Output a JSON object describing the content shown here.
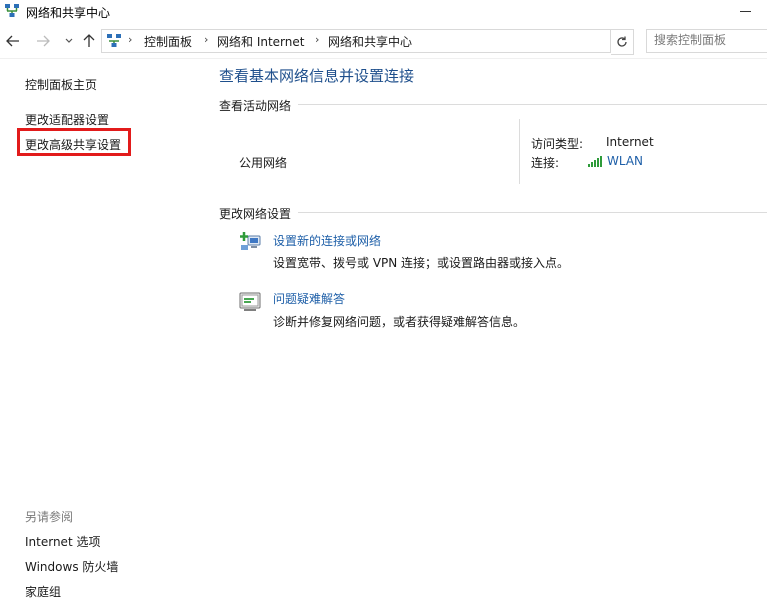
{
  "window": {
    "title": "网络和共享中心"
  },
  "address": {
    "breadcrumbs": [
      "控制面板",
      "网络和 Internet",
      "网络和共享中心"
    ],
    "search_placeholder": "搜索控制面板"
  },
  "sidebar": {
    "items": [
      {
        "label": "控制面板主页"
      },
      {
        "label": "更改适配器设置"
      },
      {
        "label": "更改高级共享设置"
      }
    ],
    "see_also_heading": "另请参阅",
    "see_also": [
      {
        "label": "Internet 选项"
      },
      {
        "label": "Windows 防火墙"
      },
      {
        "label": "家庭组"
      }
    ]
  },
  "main": {
    "title": "查看基本网络信息并设置连接",
    "active_networks_heading": "查看活动网络",
    "network": {
      "name": "公用网络",
      "access_type_label": "访问类型:",
      "access_type_value": "Internet",
      "connection_label": "连接:",
      "connection_value": "WLAN"
    },
    "change_settings_heading": "更改网络设置",
    "tasks": [
      {
        "title": "设置新的连接或网络",
        "description": "设置宽带、拨号或 VPN 连接；或设置路由器或接入点。",
        "icon": "network-setup-icon"
      },
      {
        "title": "问题疑难解答",
        "description": "诊断并修复网络问题，或者获得疑难解答信息。",
        "icon": "troubleshoot-icon"
      }
    ]
  },
  "colors": {
    "link": "#1e5fa8",
    "title": "#1e4f8c",
    "highlight": "#e21b1b"
  }
}
